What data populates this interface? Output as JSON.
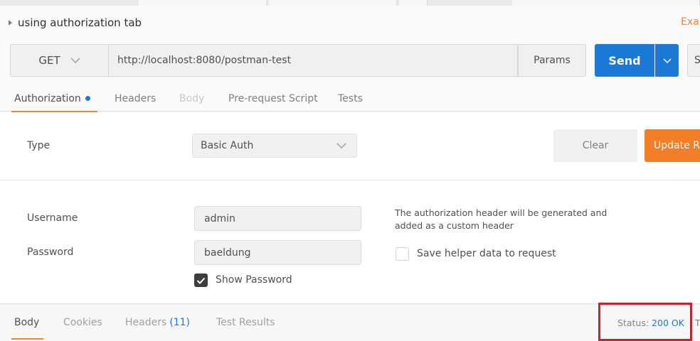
{
  "request": {
    "title": "using authorization tab",
    "examples_label": "Exar",
    "method": "GET",
    "url": "http://localhost:8080/postman-test",
    "params_label": "Params",
    "send_label": "Send",
    "save_label": "S"
  },
  "request_tabs": [
    {
      "label": "Authorization",
      "state": "active"
    },
    {
      "label": "Headers",
      "state": "normal"
    },
    {
      "label": "Body",
      "state": "disabled"
    },
    {
      "label": "Pre-request Script",
      "state": "normal"
    },
    {
      "label": "Tests",
      "state": "normal"
    }
  ],
  "auth": {
    "type_label": "Type",
    "type_value": "Basic Auth",
    "clear_label": "Clear",
    "update_label": "Update Re",
    "username_label": "Username",
    "username_value": "admin",
    "password_label": "Password",
    "password_value": "baeldung",
    "show_password_label": "Show Password",
    "show_password_checked": true,
    "helper_text": "The authorization header will be generated and added as a custom header",
    "save_helper_label": "Save helper data to request",
    "save_helper_checked": false
  },
  "response": {
    "tabs": [
      {
        "label": "Body",
        "state": "active"
      },
      {
        "label": "Cookies",
        "state": "normal"
      },
      {
        "label": "Headers",
        "count": "(11)",
        "state": "normal"
      },
      {
        "label": "Test Results",
        "state": "normal"
      }
    ],
    "status_label": "Status:",
    "status_value": "200 OK",
    "time_label": "T"
  },
  "colors": {
    "accent_blue": "#1c78d5",
    "accent_orange": "#f27f27",
    "tab_underline": "#e8863a",
    "highlight_red": "#c0242c"
  }
}
